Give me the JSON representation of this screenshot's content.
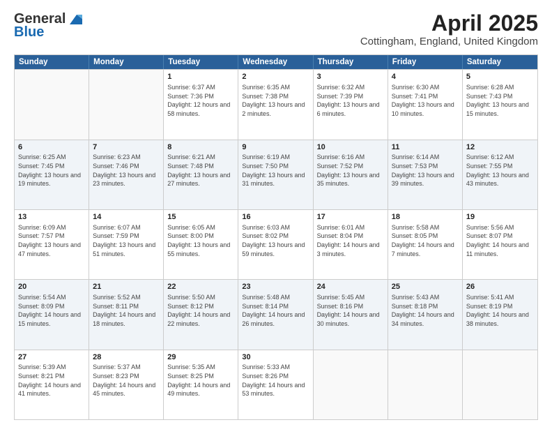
{
  "header": {
    "logo_line1": "General",
    "logo_line2": "Blue",
    "main_title": "April 2025",
    "subtitle": "Cottingham, England, United Kingdom"
  },
  "calendar": {
    "days_of_week": [
      "Sunday",
      "Monday",
      "Tuesday",
      "Wednesday",
      "Thursday",
      "Friday",
      "Saturday"
    ],
    "rows": [
      [
        {
          "day": "",
          "info": "",
          "empty": true
        },
        {
          "day": "",
          "info": "",
          "empty": true
        },
        {
          "day": "1",
          "info": "Sunrise: 6:37 AM\nSunset: 7:36 PM\nDaylight: 12 hours and 58 minutes."
        },
        {
          "day": "2",
          "info": "Sunrise: 6:35 AM\nSunset: 7:38 PM\nDaylight: 13 hours and 2 minutes."
        },
        {
          "day": "3",
          "info": "Sunrise: 6:32 AM\nSunset: 7:39 PM\nDaylight: 13 hours and 6 minutes."
        },
        {
          "day": "4",
          "info": "Sunrise: 6:30 AM\nSunset: 7:41 PM\nDaylight: 13 hours and 10 minutes."
        },
        {
          "day": "5",
          "info": "Sunrise: 6:28 AM\nSunset: 7:43 PM\nDaylight: 13 hours and 15 minutes."
        }
      ],
      [
        {
          "day": "6",
          "info": "Sunrise: 6:25 AM\nSunset: 7:45 PM\nDaylight: 13 hours and 19 minutes."
        },
        {
          "day": "7",
          "info": "Sunrise: 6:23 AM\nSunset: 7:46 PM\nDaylight: 13 hours and 23 minutes."
        },
        {
          "day": "8",
          "info": "Sunrise: 6:21 AM\nSunset: 7:48 PM\nDaylight: 13 hours and 27 minutes."
        },
        {
          "day": "9",
          "info": "Sunrise: 6:19 AM\nSunset: 7:50 PM\nDaylight: 13 hours and 31 minutes."
        },
        {
          "day": "10",
          "info": "Sunrise: 6:16 AM\nSunset: 7:52 PM\nDaylight: 13 hours and 35 minutes."
        },
        {
          "day": "11",
          "info": "Sunrise: 6:14 AM\nSunset: 7:53 PM\nDaylight: 13 hours and 39 minutes."
        },
        {
          "day": "12",
          "info": "Sunrise: 6:12 AM\nSunset: 7:55 PM\nDaylight: 13 hours and 43 minutes."
        }
      ],
      [
        {
          "day": "13",
          "info": "Sunrise: 6:09 AM\nSunset: 7:57 PM\nDaylight: 13 hours and 47 minutes."
        },
        {
          "day": "14",
          "info": "Sunrise: 6:07 AM\nSunset: 7:59 PM\nDaylight: 13 hours and 51 minutes."
        },
        {
          "day": "15",
          "info": "Sunrise: 6:05 AM\nSunset: 8:00 PM\nDaylight: 13 hours and 55 minutes."
        },
        {
          "day": "16",
          "info": "Sunrise: 6:03 AM\nSunset: 8:02 PM\nDaylight: 13 hours and 59 minutes."
        },
        {
          "day": "17",
          "info": "Sunrise: 6:01 AM\nSunset: 8:04 PM\nDaylight: 14 hours and 3 minutes."
        },
        {
          "day": "18",
          "info": "Sunrise: 5:58 AM\nSunset: 8:05 PM\nDaylight: 14 hours and 7 minutes."
        },
        {
          "day": "19",
          "info": "Sunrise: 5:56 AM\nSunset: 8:07 PM\nDaylight: 14 hours and 11 minutes."
        }
      ],
      [
        {
          "day": "20",
          "info": "Sunrise: 5:54 AM\nSunset: 8:09 PM\nDaylight: 14 hours and 15 minutes."
        },
        {
          "day": "21",
          "info": "Sunrise: 5:52 AM\nSunset: 8:11 PM\nDaylight: 14 hours and 18 minutes."
        },
        {
          "day": "22",
          "info": "Sunrise: 5:50 AM\nSunset: 8:12 PM\nDaylight: 14 hours and 22 minutes."
        },
        {
          "day": "23",
          "info": "Sunrise: 5:48 AM\nSunset: 8:14 PM\nDaylight: 14 hours and 26 minutes."
        },
        {
          "day": "24",
          "info": "Sunrise: 5:45 AM\nSunset: 8:16 PM\nDaylight: 14 hours and 30 minutes."
        },
        {
          "day": "25",
          "info": "Sunrise: 5:43 AM\nSunset: 8:18 PM\nDaylight: 14 hours and 34 minutes."
        },
        {
          "day": "26",
          "info": "Sunrise: 5:41 AM\nSunset: 8:19 PM\nDaylight: 14 hours and 38 minutes."
        }
      ],
      [
        {
          "day": "27",
          "info": "Sunrise: 5:39 AM\nSunset: 8:21 PM\nDaylight: 14 hours and 41 minutes."
        },
        {
          "day": "28",
          "info": "Sunrise: 5:37 AM\nSunset: 8:23 PM\nDaylight: 14 hours and 45 minutes."
        },
        {
          "day": "29",
          "info": "Sunrise: 5:35 AM\nSunset: 8:25 PM\nDaylight: 14 hours and 49 minutes."
        },
        {
          "day": "30",
          "info": "Sunrise: 5:33 AM\nSunset: 8:26 PM\nDaylight: 14 hours and 53 minutes."
        },
        {
          "day": "",
          "info": "",
          "empty": true
        },
        {
          "day": "",
          "info": "",
          "empty": true
        },
        {
          "day": "",
          "info": "",
          "empty": true
        }
      ]
    ]
  }
}
